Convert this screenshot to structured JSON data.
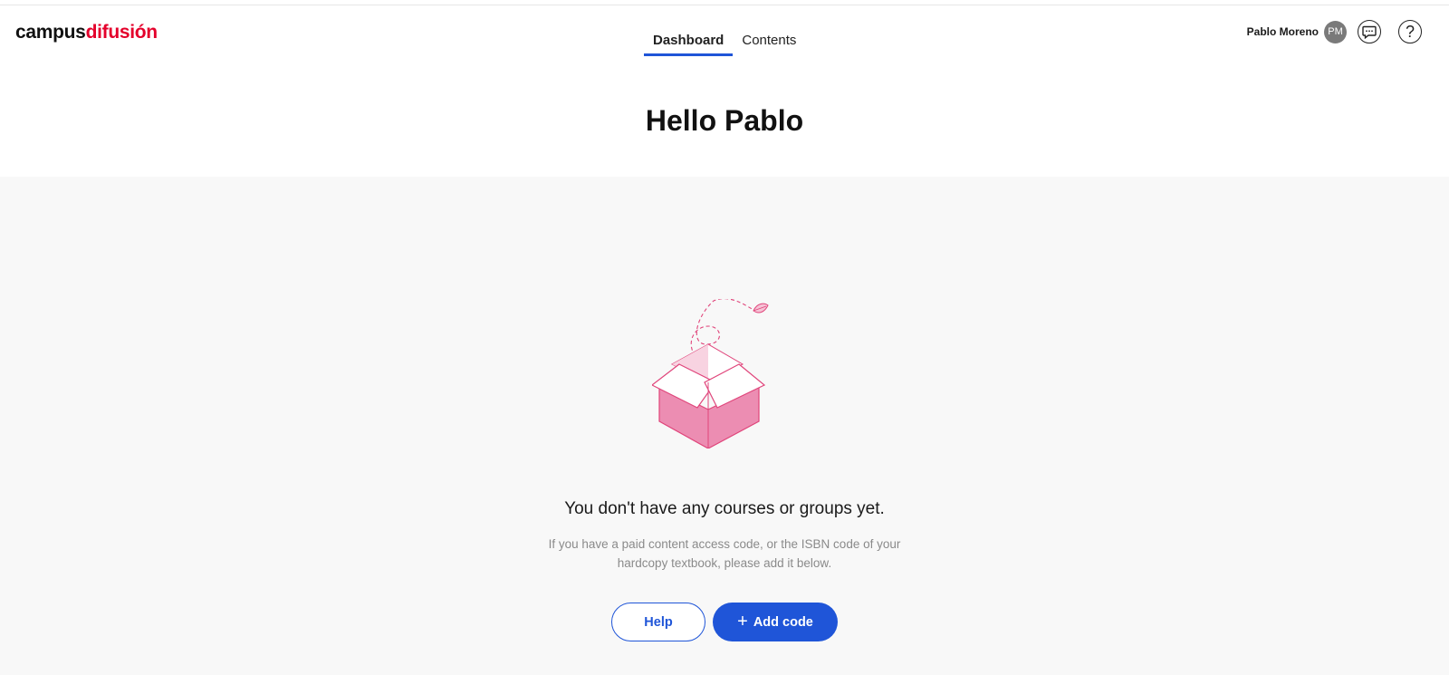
{
  "brand": {
    "part1": "campus",
    "part2": "difusión"
  },
  "nav": {
    "tabs": [
      {
        "label": "Dashboard"
      },
      {
        "label": "Contents"
      }
    ]
  },
  "user": {
    "name": "Pablo Moreno",
    "initials": "PM",
    "help_glyph": "?"
  },
  "greeting": "Hello Pablo",
  "empty_state": {
    "title": "You don't have any courses or groups yet.",
    "description": "If you have a paid content access code, or the ISBN code of your hardcopy textbook, please add it below."
  },
  "actions": {
    "help_label": "Help",
    "add_icon": "+",
    "add_label": "Add code"
  },
  "colors": {
    "accent": "#1f55d8",
    "brand_red": "#e4002b",
    "box_pink": "#ec8db2",
    "box_outline": "#e0457b"
  }
}
